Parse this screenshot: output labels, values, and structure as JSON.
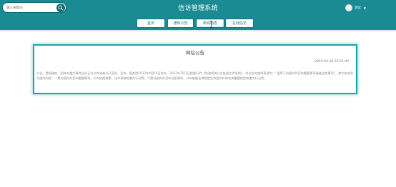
{
  "header": {
    "search_placeholder": "输入关键词",
    "title": "信访管理系统",
    "username": "测试"
  },
  "nav": {
    "items": [
      {
        "label": "首页"
      },
      {
        "label": "通知公告"
      },
      {
        "label": "新闻动态"
      },
      {
        "label": "在线信访"
      }
    ],
    "active_index": 2
  },
  "notice": {
    "title": "网站公告",
    "date": "2025-04-30 19:21:49",
    "body": "公告。是指政府、团体对重大事件当众正式公布或者公开宣告、宣布。国务院2012年4月16日发布、2012年7月1日起施行的《党政机关公文处理工作条例》，对公告的使用表述为：“适用于向国内外宣布重要事项或者法定事项”。其中包含两方面的内容：一是向国内外宣布重要事项，公布依据政策、法令采取的重大行动等；二是向国内外宣布法定事项，公布依据法律规定告知国内外的有关重要规定和重大行动等。"
  },
  "colors": {
    "primary": "#1a8a93",
    "card_border": "#1aa6b0"
  }
}
